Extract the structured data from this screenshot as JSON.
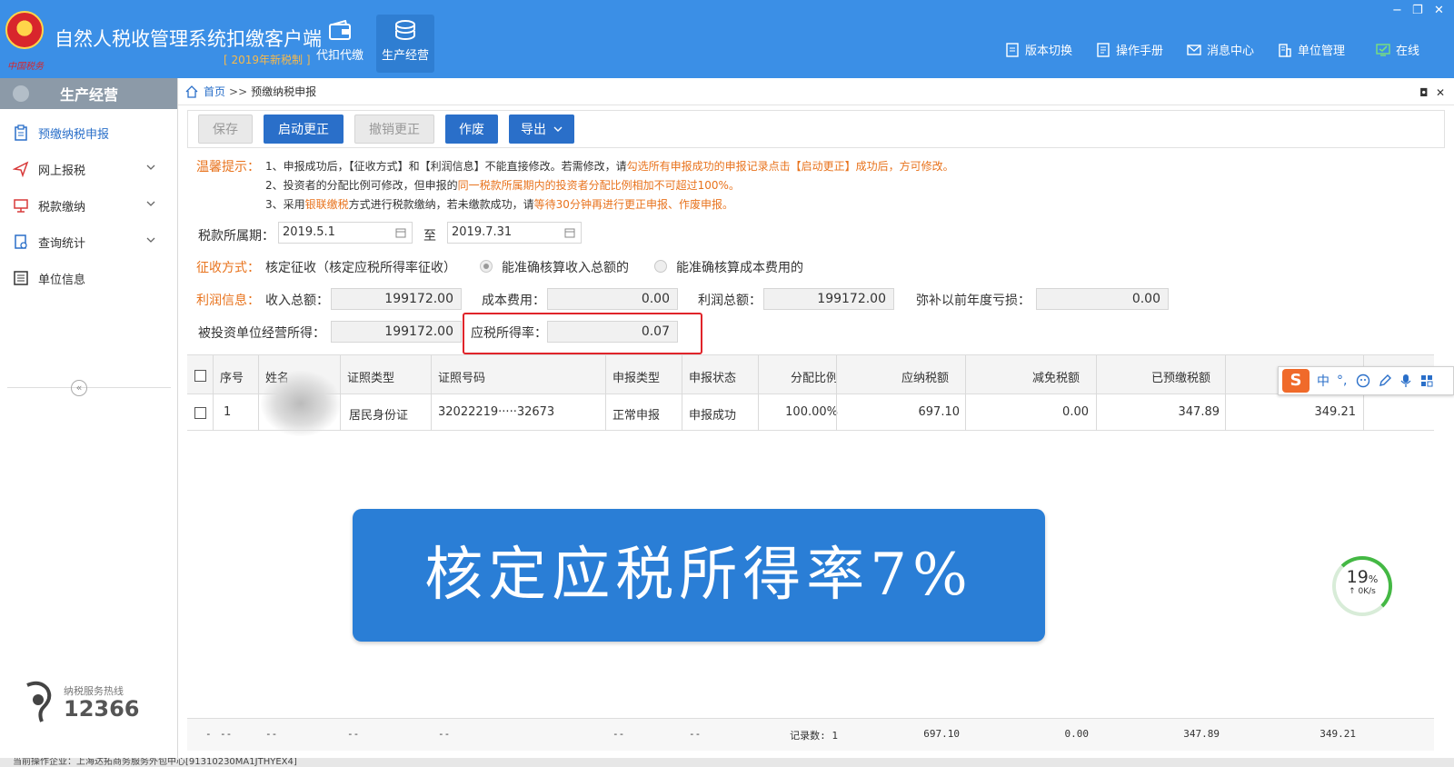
{
  "app": {
    "title": "自然人税收管理系统扣缴客户端",
    "subtitle": "[ 2019年新税制 ]",
    "logo_text": "中国税务",
    "nav": [
      {
        "label": "代扣代缴",
        "icon": "wallet-icon"
      },
      {
        "label": "生产经营",
        "icon": "coins-icon"
      }
    ],
    "links": [
      {
        "label": "版本切换",
        "icon": "version-icon"
      },
      {
        "label": "操作手册",
        "icon": "manual-icon"
      },
      {
        "label": "消息中心",
        "icon": "mail-icon"
      },
      {
        "label": "单位管理",
        "icon": "building-icon"
      },
      {
        "label": "在线",
        "icon": "online-monitor-icon"
      }
    ],
    "window": {
      "minimize": "−",
      "restore": "❐",
      "close": "✕"
    }
  },
  "sidebar": {
    "title": "生产经营",
    "items": [
      {
        "label": "预缴纳税申报",
        "icon": "clipboard-icon"
      },
      {
        "label": "网上报税",
        "icon": "send-icon"
      },
      {
        "label": "税款缴纳",
        "icon": "payment-terminal-icon"
      },
      {
        "label": "查询统计",
        "icon": "report-icon"
      },
      {
        "label": "单位信息",
        "icon": "list-icon"
      }
    ],
    "collapse": "«",
    "hotline_label": "纳税服务热线",
    "hotline_number": "12366"
  },
  "breadcrumb": {
    "home": "首页",
    "sep": ">>",
    "current": "预缴纳税申报"
  },
  "tab_controls": {
    "restore": "◘",
    "close": "✕"
  },
  "toolbar": {
    "save": "保存",
    "start_correction": "启动更正",
    "cancel_correction": "撤销更正",
    "void": "作废",
    "export": "导出"
  },
  "tips": {
    "title": "温馨提示：",
    "line1_a": "1、申报成功后，【征收方式】和【利润信息】不能直接修改。若需修改，请",
    "line1_b": "勾选所有申报成功的申报记录点击【启动更正】成功后，方可修改。",
    "line2_a": "2、投资者的分配比例可修改，但申报的",
    "line2_b": "同一税款所属期内的投资者分配比例相加不可超过100%。",
    "line3_a": "3、采用",
    "line3_b": "银联缴税",
    "line3_c": "方式进行税款缴纳，若未缴款成功，请",
    "line3_d": "等待30分钟再进行更正申报、作废申报。"
  },
  "form": {
    "period_label": "税款所属期：",
    "period_start": "2019.5.1",
    "period_to": "至",
    "period_end": "2019.7.31",
    "method_label": "征收方式：",
    "method_value": "核定征收（核定应税所得率征收）",
    "method_opt1": "能准确核算收入总额的",
    "method_opt2": "能准确核算成本费用的",
    "profit_label": "利润信息：",
    "income_label": "收入总额：",
    "income_value": "199172.00",
    "cost_label": "成本费用：",
    "cost_value": "0.00",
    "profit_total_label": "利润总额：",
    "profit_total_value": "199172.00",
    "loss_label": "弥补以前年度亏损：",
    "loss_value": "0.00",
    "invest_label": "被投资单位经营所得：",
    "invest_value": "199172.00",
    "rate_label": "应税所得率：",
    "rate_value": "0.07"
  },
  "table": {
    "headers": [
      "序号",
      "姓名",
      "证照类型",
      "证照号码",
      "申报类型",
      "申报状态",
      "分配比例",
      "应纳税额",
      "减免税额",
      "已预缴税额",
      ""
    ],
    "rows": [
      [
        "1",
        "",
        "居民身份证",
        "32022219·····32673",
        "正常申报",
        "申报成功",
        "100.00%",
        "697.10",
        "0.00",
        "347.89",
        "349.21"
      ]
    ],
    "footer": [
      "-",
      "--",
      "--",
      "--",
      "--",
      "--",
      "--",
      "记录数: 1",
      "697.10",
      "0.00",
      "347.89",
      "349.21"
    ]
  },
  "banner": "核定应税所得率7%",
  "ime": {
    "logo": "S",
    "mode": "中",
    "punct": "°,"
  },
  "meter": {
    "percent": "19",
    "unit": "%",
    "speed": "↑ 0K/s"
  },
  "statusbar": "当前操作企业：上海达拓商务服务外包中心[91310230MA1JTHYEX4]"
}
